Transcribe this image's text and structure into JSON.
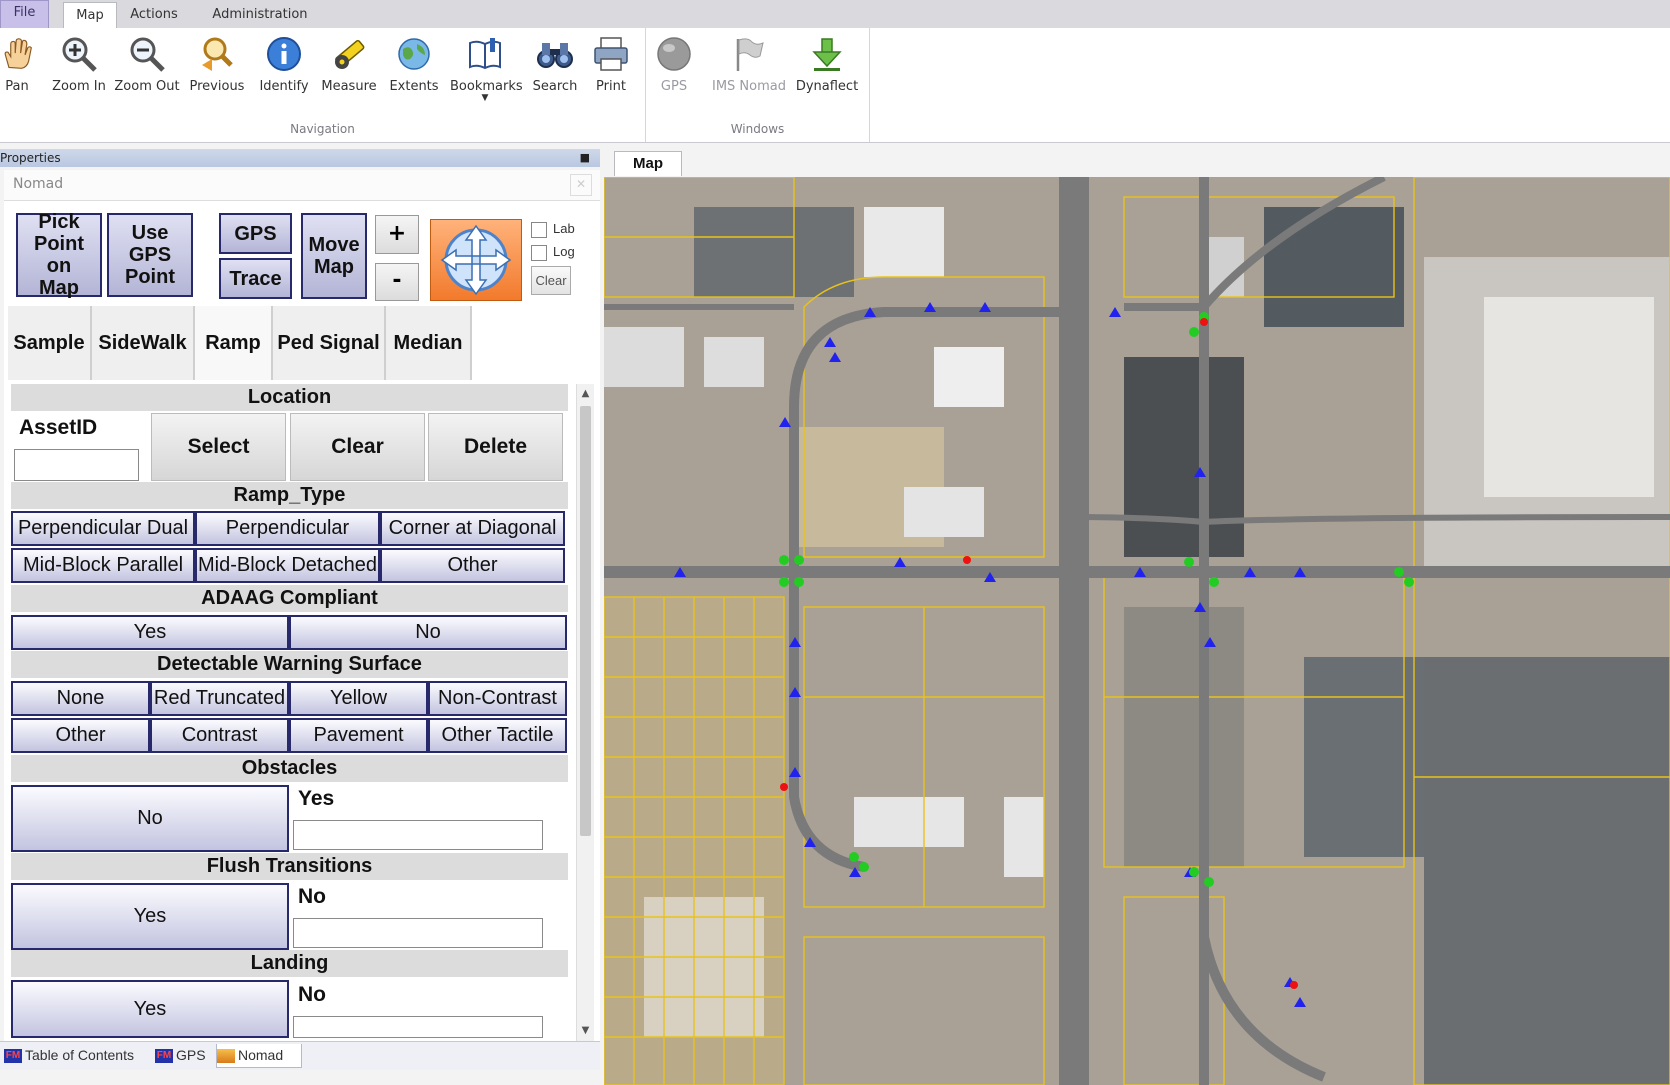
{
  "ribbon": {
    "tabs": {
      "file": "File",
      "map": "Map",
      "actions": "Actions",
      "administration": "Administration"
    },
    "navigation": {
      "label": "Navigation",
      "buttons": {
        "pan": "Pan",
        "zoom_in": "Zoom In",
        "zoom_out": "Zoom Out",
        "previous": "Previous",
        "identify": "Identify",
        "measure": "Measure",
        "extents": "Extents",
        "bookmarks": "Bookmarks",
        "search": "Search",
        "print": "Print"
      }
    },
    "windows": {
      "label": "Windows",
      "buttons": {
        "gps": "GPS",
        "ims_nomad": "IMS Nomad",
        "dynaflect": "Dynaflect"
      }
    }
  },
  "properties": {
    "header": "Properties",
    "window_title": "Nomad",
    "controls": {
      "pick_point": "Pick Point on Map",
      "use_gps": "Use GPS Point",
      "gps": "GPS",
      "trace": "Trace",
      "move_map": "Move Map",
      "plus": "+",
      "minus": "-",
      "lab": "Lab",
      "log": "Log",
      "clear": "Clear"
    },
    "tabs": {
      "sample": "Sample",
      "sidewalk": "SideWalk",
      "ramp": "Ramp",
      "ped_signal": "Ped Signal",
      "median": "Median"
    },
    "form": {
      "location": {
        "title": "Location",
        "assetid_label": "AssetID",
        "assetid_value": "",
        "select": "Select",
        "clear": "Clear",
        "delete": "Delete"
      },
      "ramp_type": {
        "title": "Ramp_Type",
        "options": [
          "Perpendicular Dual",
          "Perpendicular",
          "Corner at Diagonal",
          "Mid-Block Parallel",
          "Mid-Block Detached",
          "Other"
        ]
      },
      "adaag": {
        "title": "ADAAG Compliant",
        "options": [
          "Yes",
          "No"
        ]
      },
      "dws": {
        "title": "Detectable Warning Surface",
        "options": [
          "None",
          "Red Truncated",
          "Yellow",
          "Non-Contrast",
          "Other",
          "Contrast",
          "Pavement",
          "Other Tactile"
        ]
      },
      "obstacles": {
        "title": "Obstacles",
        "button": "No",
        "alt_label": "Yes",
        "value": ""
      },
      "flush": {
        "title": "Flush Transitions",
        "button": "Yes",
        "alt_label": "No",
        "value": ""
      },
      "landing": {
        "title": "Landing",
        "button": "Yes",
        "alt_label": "No",
        "value": ""
      }
    },
    "bottom_tabs": {
      "toc": "Table of Contents",
      "gps": "GPS",
      "nomad": "Nomad"
    }
  },
  "map": {
    "tab": "Map",
    "colors": {
      "parcel": "#e8c21c",
      "ramp_marker": "#2222ee",
      "signal_marker": "#22cc22",
      "issue_marker": "#ee1111",
      "road": "#7a7a7a"
    }
  }
}
